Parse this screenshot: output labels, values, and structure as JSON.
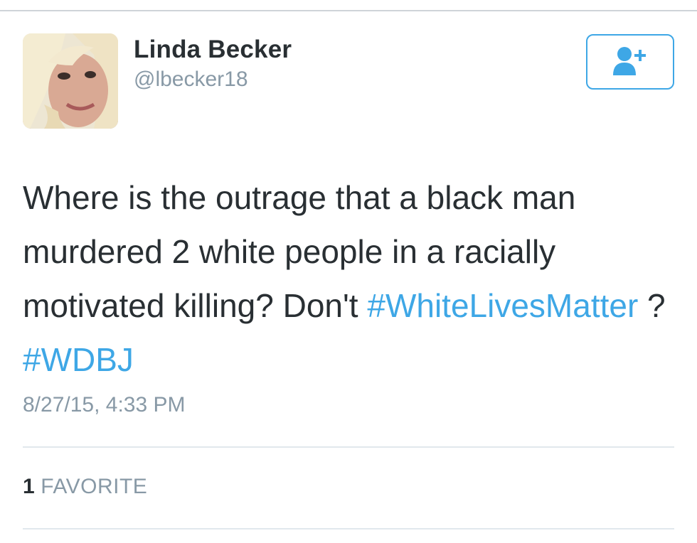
{
  "user": {
    "name": "Linda Becker",
    "handle": "@lbecker18"
  },
  "tweet": {
    "text_part_1": "Where is the outrage that a black man murdered 2 white people in a racially motivated killing? Don't ",
    "hashtag_1": "#WhiteLivesMatter",
    "text_part_2": " ? ",
    "hashtag_2": "#WDBJ",
    "timestamp": "8/27/15, 4:33 PM"
  },
  "stats": {
    "favorite_count": "1",
    "favorite_label": "FAVORITE"
  },
  "colors": {
    "accent": "#3ea7e6",
    "text": "#292f33",
    "muted": "#8899a6",
    "divider": "#e1e8ed"
  },
  "icons": {
    "follow": "add-user-icon",
    "avatar": "profile-photo"
  }
}
